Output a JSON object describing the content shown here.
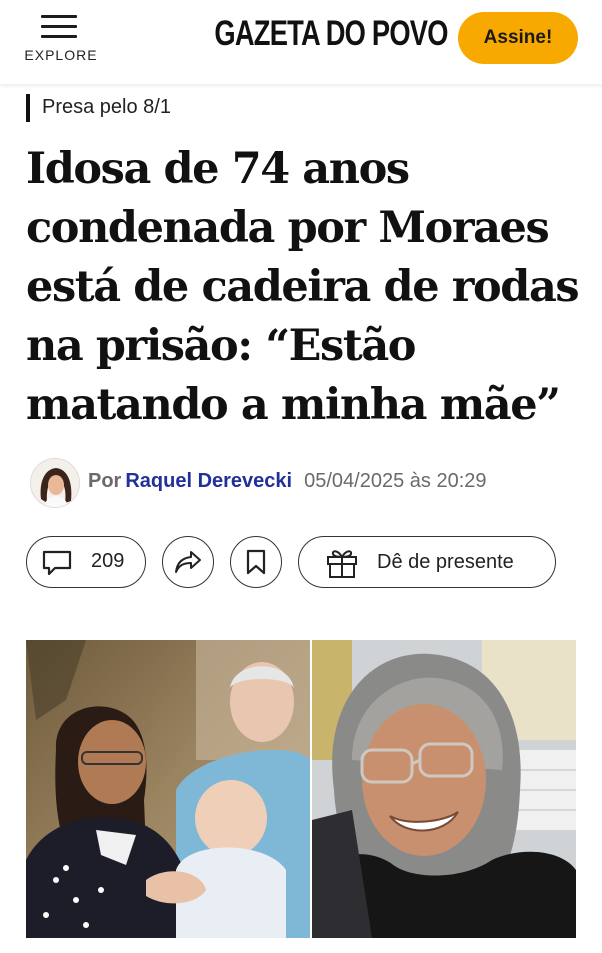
{
  "header": {
    "menu_label": "EXPLORE",
    "logo_text": "GAZETA DO POVO",
    "subscribe_label": "Assine!",
    "subscribe_color": "#f8a900"
  },
  "article": {
    "kicker": "Presa pelo 8/1",
    "headline": "Idosa de 74 anos condenada por Moraes está de cadeira de rodas na prisão: “Estão matando a minha mãe”",
    "byline": {
      "prefix": "Por",
      "author": "Raquel Derevecki",
      "author_color": "#22319a",
      "date": "05/04/2025 às 20:29"
    },
    "actions": {
      "comments_count": "209",
      "gift_label": "Dê de presente"
    },
    "icons": [
      "hamburger-menu-icon",
      "comment-icon",
      "share-icon",
      "bookmark-icon",
      "gift-icon"
    ]
  }
}
